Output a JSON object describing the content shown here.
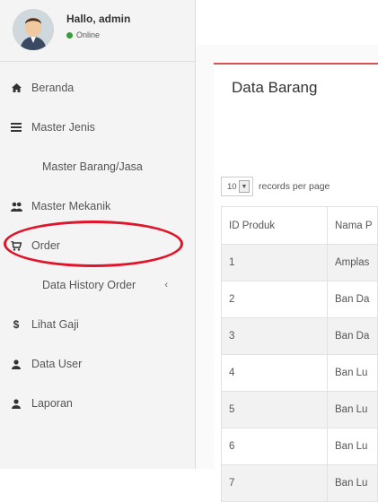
{
  "user": {
    "greeting": "Hallo, admin",
    "status": "Online"
  },
  "sidebar": {
    "items": [
      {
        "label": "Beranda",
        "icon": "home-icon"
      },
      {
        "label": "Master Jenis",
        "icon": "list-icon"
      },
      {
        "label": "Master Barang/Jasa",
        "icon": ""
      },
      {
        "label": "Master Mekanik",
        "icon": "users-icon"
      },
      {
        "label": "Order",
        "icon": "cart-icon"
      },
      {
        "label": "Data History Order",
        "icon": ""
      },
      {
        "label": "Lihat Gaji",
        "icon": "dollar-icon"
      },
      {
        "label": "Data User",
        "icon": "user-icon"
      },
      {
        "label": "Laporan",
        "icon": "user-icon"
      }
    ]
  },
  "main": {
    "title": "Data Barang",
    "length_value": "10",
    "length_label": "records per page",
    "table": {
      "headers": [
        "ID Produk",
        "Nama P"
      ],
      "rows": [
        [
          "1",
          "Amplas"
        ],
        [
          "2",
          "Ban Da"
        ],
        [
          "3",
          "Ban Da"
        ],
        [
          "4",
          "Ban Lu"
        ],
        [
          "5",
          "Ban Lu"
        ],
        [
          "6",
          "Ban Lu"
        ],
        [
          "7",
          "Ban Lu"
        ]
      ]
    }
  },
  "colors": {
    "highlight": "#e0142b",
    "box_accent": "#d9534f",
    "online": "#3c9a3c"
  }
}
